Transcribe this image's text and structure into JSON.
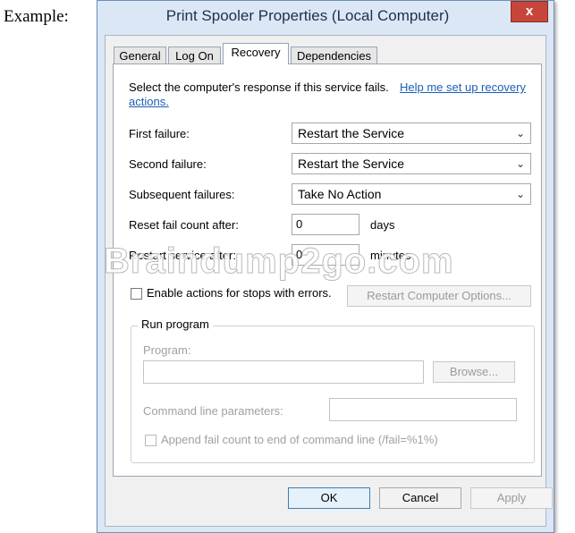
{
  "caption": "Example:",
  "window": {
    "title": "Print Spooler Properties (Local Computer)",
    "close_label": "x"
  },
  "tabs": [
    {
      "label": "General"
    },
    {
      "label": "Log On"
    },
    {
      "label": "Recovery",
      "active": true
    },
    {
      "label": "Dependencies"
    }
  ],
  "recovery": {
    "intro": "Select the computer's response if this service fails.",
    "help_link_line1": "Help me set up recovery",
    "help_link_line2": "actions.",
    "first_failure_label": "First failure:",
    "first_failure_value": "Restart the Service",
    "second_failure_label": "Second failure:",
    "second_failure_value": "Restart the Service",
    "subsequent_label": "Subsequent failures:",
    "subsequent_value": "Take No Action",
    "reset_label": "Reset fail count after:",
    "reset_value": "0",
    "reset_unit": "days",
    "restart_label": "Restart service after:",
    "restart_value": "0",
    "restart_unit": "minutes",
    "enable_actions_label": "Enable actions for stops with errors.",
    "restart_computer_button": "Restart Computer Options..."
  },
  "run_program": {
    "group_title": "Run program",
    "program_label": "Program:",
    "program_value": "",
    "browse_button": "Browse...",
    "cmd_label": "Command line parameters:",
    "cmd_value": "",
    "append_label": "Append fail count to end of command line (/fail=%1%)"
  },
  "footer": {
    "ok": "OK",
    "cancel": "Cancel",
    "apply": "Apply"
  },
  "watermark": "Braindump2go.com",
  "colors": {
    "window_frame": "#dbe7f5",
    "close_button": "#c7463b",
    "link": "#1a5fb4"
  }
}
